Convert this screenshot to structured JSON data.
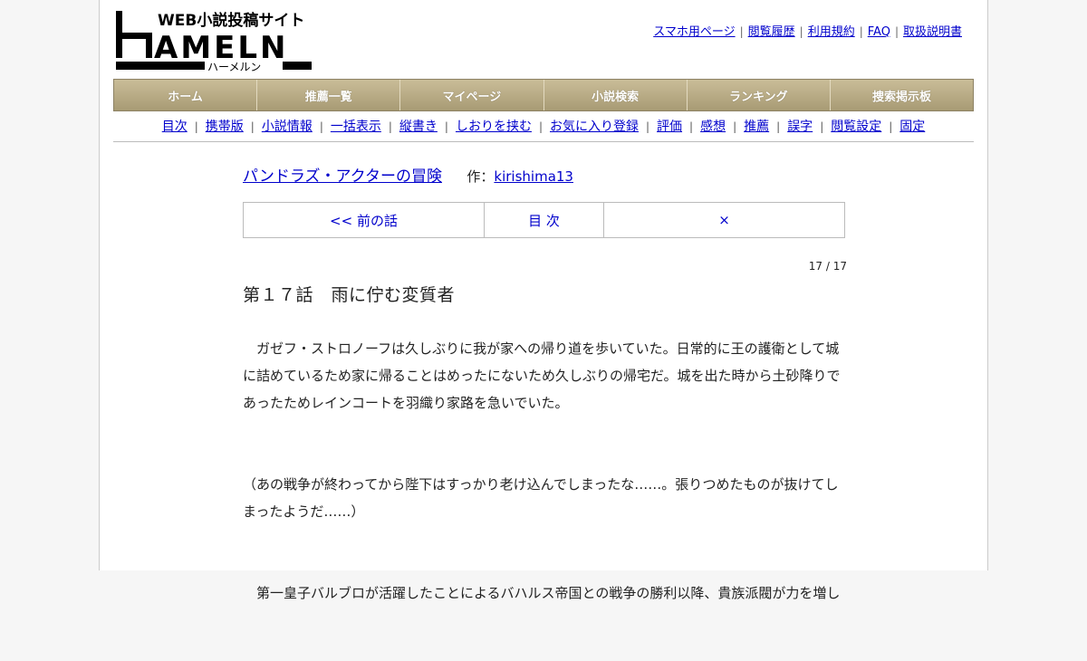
{
  "logo": {
    "main_text": "HAMELN",
    "tagline": "WEB小説投稿サイト",
    "subtitle": "ハーメルン"
  },
  "toplinks": [
    "スマホ用ページ",
    "閲覧履歴",
    "利用規約",
    "FAQ",
    "取扱説明書"
  ],
  "mainnav": [
    "ホーム",
    "推薦一覧",
    "マイページ",
    "小説検索",
    "ランキング",
    "捜索掲示板"
  ],
  "subnav": [
    "目次",
    "携帯版",
    "小説情報",
    "一括表示",
    "縦書き",
    "しおりを挟む",
    "お気に入り登録",
    "評価",
    "感想",
    "推薦",
    "誤字",
    "閲覧設定",
    "固定"
  ],
  "novel": {
    "title": "パンドラズ・アクターの冒険",
    "author_prefix": "作：",
    "author": "kirishima13"
  },
  "pager": {
    "prev": "<< 前の話",
    "toc": "目 次",
    "close": "×"
  },
  "counter": "17 / 17",
  "chapter_title": "第１７話　雨に佇む変質者",
  "paragraphs": [
    "　ガゼフ・ストロノーフは久しぶりに我が家への帰り道を歩いていた。日常的に王の護衛として城に詰めているため家に帰ることはめったにないため久しぶりの帰宅だ。城を出た時から土砂降りであったためレインコートを羽織り家路を急いでいた。",
    "（あの戦争が終わってから陛下はすっかり老け込んでしまったな……。張りつめたものが抜けてしまったようだ……）",
    "　第一皇子バルブロが活躍したことによるバハルス帝国との戦争の勝利以降、貴族派閥が力を増し"
  ]
}
